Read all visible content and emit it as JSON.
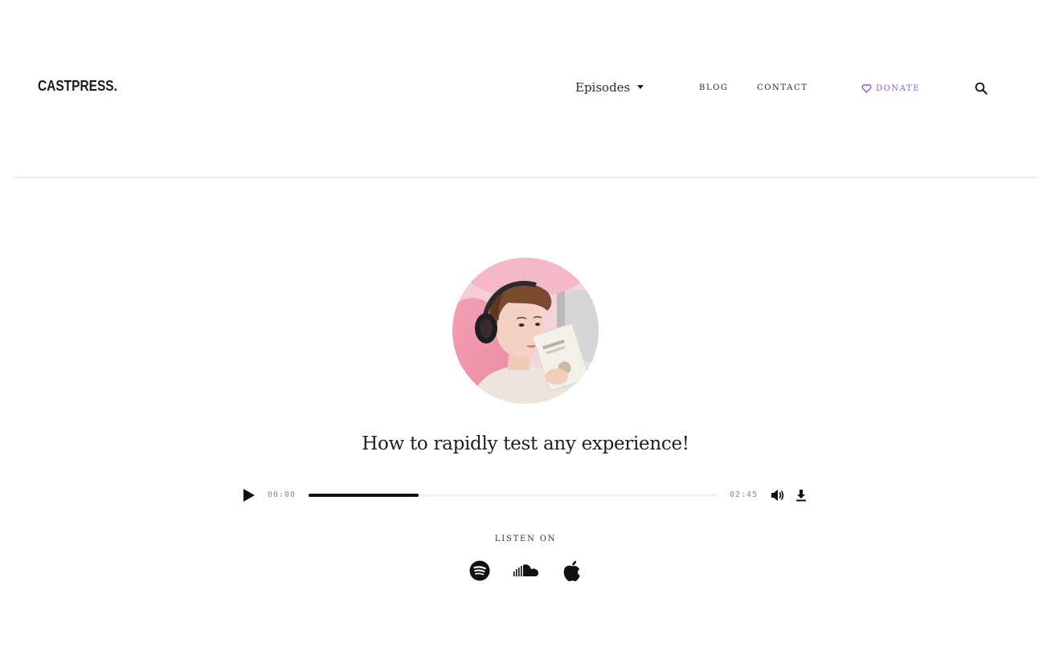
{
  "header": {
    "logo": "CASTPRESS.",
    "nav": {
      "episodes": "Episodes",
      "blog": "BLOG",
      "contact": "CONTACT",
      "donate": "DONATE"
    },
    "icons": {
      "episodes_dropdown": "caret-down-icon",
      "donate": "heart-outline-icon",
      "search": "search-icon"
    }
  },
  "episode": {
    "title": "How to rapidly test any experience!",
    "cover_image": "person-with-headphones-reading-photo"
  },
  "player": {
    "current_time": "00:00",
    "total_time": "02:45",
    "progress": 0.27,
    "icons": {
      "play": "play-icon",
      "volume": "volume-icon",
      "download": "download-icon"
    }
  },
  "listen_on": {
    "label": "LISTEN ON",
    "platforms": [
      {
        "name": "Spotify",
        "icon": "spotify-icon"
      },
      {
        "name": "SoundCloud",
        "icon": "soundcloud-icon"
      },
      {
        "name": "Apple Podcasts",
        "icon": "apple-icon"
      }
    ]
  },
  "colors": {
    "accent": "#8a5cd0",
    "text": "#1e1e1e",
    "muted": "#8a8a8a",
    "divider": "#ececec",
    "progress_fill": "#111111"
  }
}
